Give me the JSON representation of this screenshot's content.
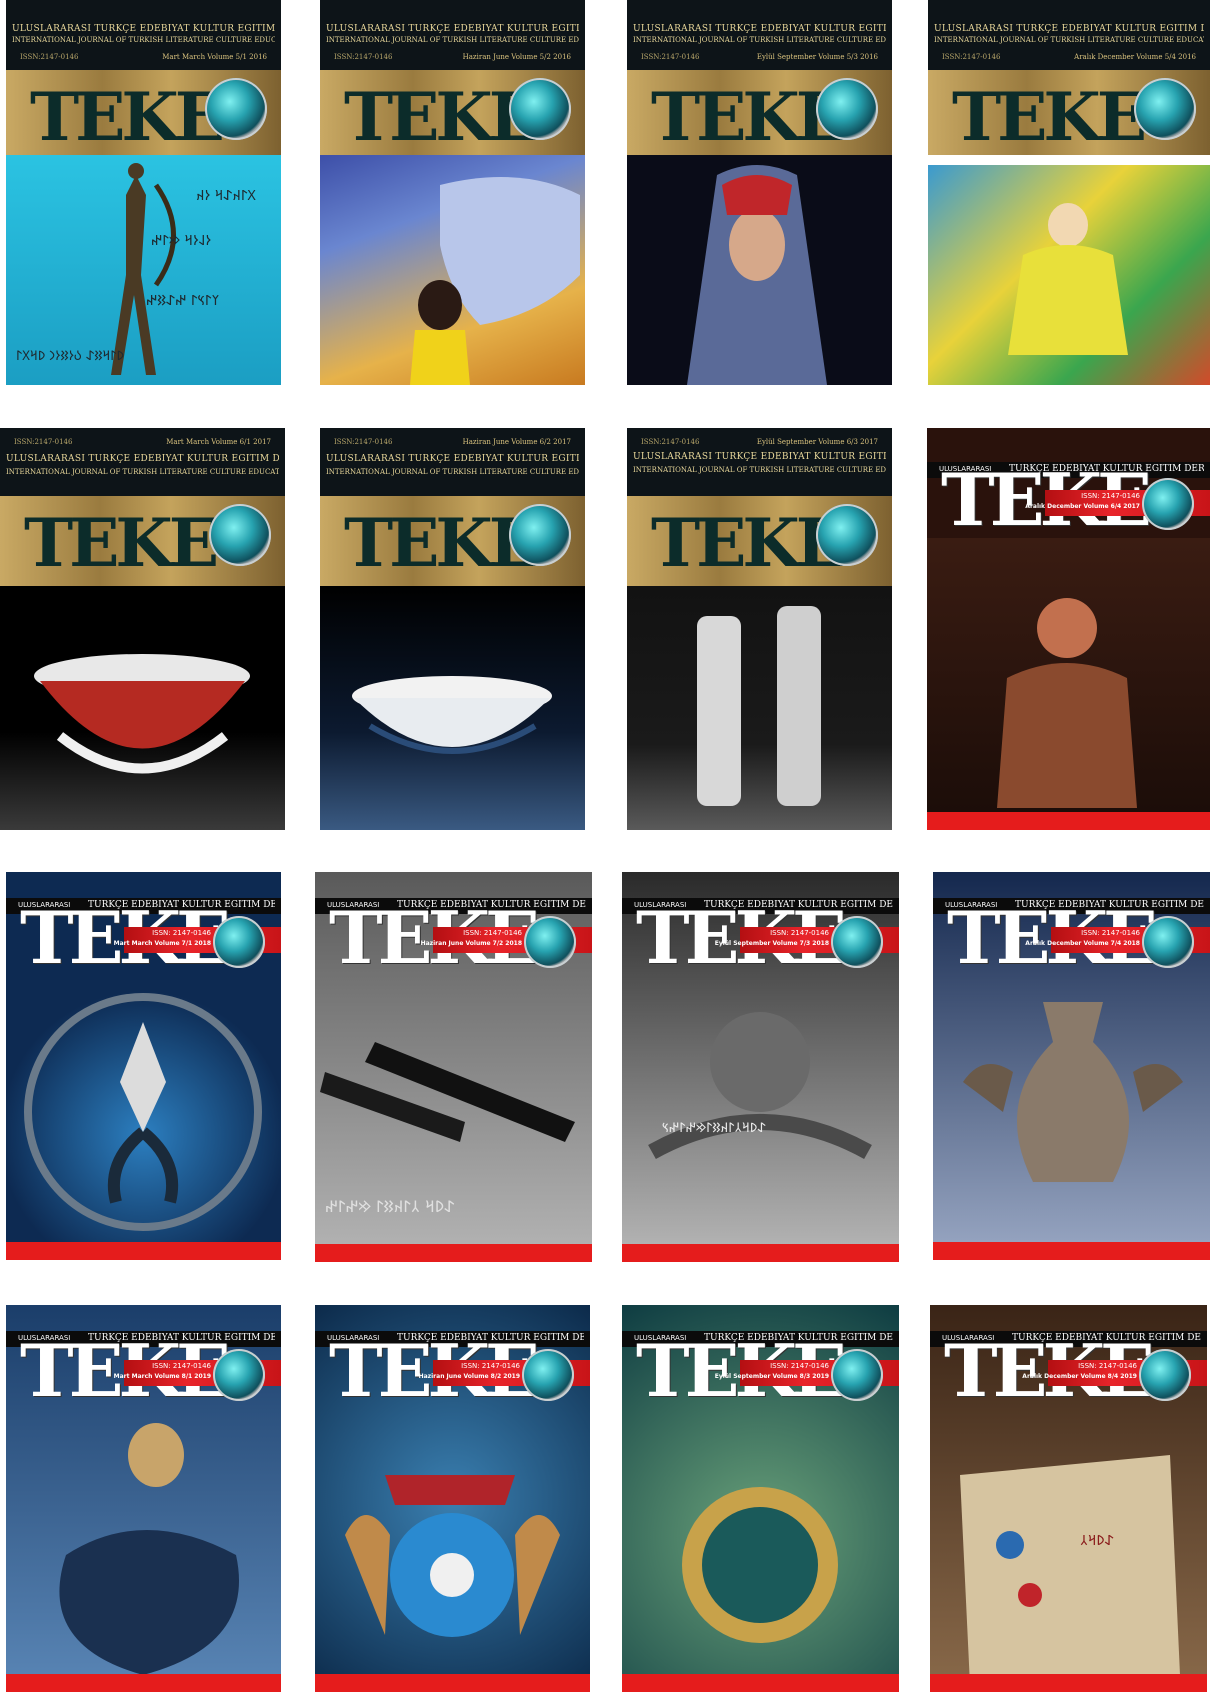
{
  "covers": [
    {
      "style": "gold",
      "title_tr": "ULUSLARARASI TÜRKÇE EDEBİYAT KÜLTÜR EĞİTİM DERGİSİ",
      "title_en": "INTERNATIONAL JOURNAL OF TURKISH LITERATURE CULTURE EDUCATION",
      "issn": "ISSN:2147-0146",
      "issue": "Mart March Volume 5/1 2016",
      "logo": "TEKE",
      "art": "archer statue with Orkhon runes on sky",
      "colors": [
        "#2bb7d6",
        "#1b93b8"
      ]
    },
    {
      "style": "gold",
      "title_tr": "ULUSLARARASI TÜRKÇE EDEBİYAT KÜLTÜR EĞİTİM DERGİSİ",
      "title_en": "INTERNATIONAL JOURNAL OF TURKISH LITERATURE CULTURE EDUCATION",
      "issn": "ISSN:2147-0146",
      "issue": "Haziran June Volume 5/2 2016",
      "logo": "TEKE",
      "art": "girl kissing horse painting",
      "colors": [
        "#5a69b6",
        "#e2a33a"
      ]
    },
    {
      "style": "gold",
      "title_tr": "ULUSLARARASI TÜRKÇE EDEBİYAT KÜLTÜR EĞİTİM DERGİSİ",
      "title_en": "INTERNATIONAL JOURNAL OF TURKISH LITERATURE CULTURE EDUCATION",
      "issn": "ISSN:2147-0146",
      "issue": "Eylül September Volume 5/3 2016",
      "logo": "TEKE",
      "art": "woman with headscarf painting",
      "colors": [
        "#0a0c18",
        "#3b4f86"
      ]
    },
    {
      "style": "gold",
      "title_tr": "ULUSLARARASI TÜRKÇE EDEBİYAT KÜLTÜR EĞİTİM DERGİSİ",
      "title_en": "INTERNATIONAL JOURNAL OF TURKISH LITERATURE CULTURE EDUCATION",
      "issn": "ISSN:2147-0146",
      "issue": "Aralık December Volume 5/4 2016",
      "logo": "TEKE",
      "art": "colorful seated figure painting",
      "colors": [
        "#3aa64e",
        "#e0c63a"
      ]
    },
    {
      "style": "gold",
      "title_tr": "ULUSLARARASI TÜRKÇE EDEBİYAT KÜLTÜR EĞİTİM DERGİSİ",
      "title_en": "INTERNATIONAL JOURNAL OF TURKISH LITERATURE CULTURE EDUCATION",
      "issn": "ISSN:2147-0146",
      "issue": "Mart March Volume 6/1 2017",
      "logo": "TEKE",
      "art": "red decorated bowl",
      "colors": [
        "#000000",
        "#b52a22"
      ]
    },
    {
      "style": "gold",
      "title_tr": "ULUSLARARASI TÜRKÇE EDEBİYAT KÜLTÜR EĞİTİM DERGİSİ",
      "title_en": "INTERNATIONAL JOURNAL OF TURKISH LITERATURE CULTURE EDUCATION",
      "issn": "ISSN:2147-0146",
      "issue": "Haziran June Volume 6/2 2017",
      "logo": "TEKE",
      "art": "blue and white bowl",
      "colors": [
        "#000000",
        "#2a4c78"
      ]
    },
    {
      "style": "gold",
      "title_tr": "ULUSLARARASI TÜRKÇE EDEBİYAT KÜLTÜR EĞİTİM DERGİSİ",
      "title_en": "INTERNATIONAL JOURNAL OF TURKISH LITERATURE CULTURE EDUCATION",
      "issn": "ISSN:2147-0146",
      "issue": "Eylül September Volume 6/3 2017",
      "logo": "TEKE",
      "art": "two stone steles",
      "colors": [
        "#1a1a1a",
        "#9a9a9a"
      ]
    },
    {
      "style": "red",
      "header_a": "ULUSLARARASI",
      "header_b": "TÜRKÇE EDEBİYAT KÜLTÜR EĞİTİM DERGİSİ",
      "issn": "ISSN: 2147-0146",
      "issue": "Aralık December Volume 6/4 2017",
      "logo": "TEKE",
      "art": "carved wooden figure",
      "colors": [
        "#2a120c",
        "#8a4a2e"
      ]
    },
    {
      "style": "red",
      "header_a": "ULUSLARARASI",
      "header_b": "TÜRKÇE EDEBİYAT KÜLTÜR EĞİTİM DERGİSİ",
      "issn": "ISSN: 2147-0146",
      "issue": "Mart March Volume 7/1 2018",
      "logo": "TEKE",
      "art": "ornamental tree motif",
      "colors": [
        "#0d2a52",
        "#2c7fc0"
      ]
    },
    {
      "style": "red",
      "header_a": "ULUSLARARASI",
      "header_b": "TÜRKÇE EDEBİYAT KÜLTÜR EĞİTİM DERGİSİ",
      "issn": "ISSN: 2147-0146",
      "issue": "Haziran June Volume 7/2 2018",
      "logo": "TEKE",
      "art": "fountain pen on runic script",
      "colors": [
        "#6e6e6e",
        "#b0b0b0"
      ]
    },
    {
      "style": "red",
      "header_a": "ULUSLARARASI",
      "header_b": "TÜRKÇE EDEBİYAT KÜLTÜR EĞİTİM DERGİSİ",
      "issn": "ISSN: 2147-0146",
      "issue": "Eylül September Volume 7/3 2018",
      "logo": "TEKE",
      "art": "silver emblem with runes",
      "colors": [
        "#3a3a3a",
        "#a8a8a8"
      ]
    },
    {
      "style": "red",
      "header_a": "ULUSLARARASI",
      "header_b": "TÜRKÇE EDEBİYAT KÜLTÜR EĞİTİM DERGİSİ",
      "issn": "ISSN: 2147-0146",
      "issue": "Aralık December Volume 7/4 2018",
      "logo": "TEKE",
      "art": "vase with horses",
      "colors": [
        "#14284e",
        "#9aa8c4"
      ]
    },
    {
      "style": "red",
      "header_a": "ULUSLARARASI",
      "header_b": "TÜRKÇE EDEBİYAT KÜLTÜR EĞİTİM DERGİSİ",
      "issn": "ISSN: 2147-0146",
      "issue": "Mart March Volume 8/1 2019",
      "logo": "TEKE",
      "art": "ceramic jug with face",
      "colors": [
        "#1b3e6a",
        "#5a86b6"
      ]
    },
    {
      "style": "red",
      "header_a": "ULUSLARARASI",
      "header_b": "TÜRKÇE EDEBİYAT KÜLTÜR EĞİTİM DERGİSİ",
      "issn": "ISSN: 2147-0146",
      "issue": "Haziran June Volume 8/2 2019",
      "logo": "TEKE",
      "art": "coat of arms with griffins",
      "colors": [
        "#0c2a4a",
        "#3a7fb0"
      ]
    },
    {
      "style": "red",
      "header_a": "ULUSLARARASI",
      "header_b": "TÜRKÇE EDEBİYAT KÜLTÜR EĞİTİM DERGİSİ",
      "issn": "ISSN: 2147-0146",
      "issue": "Eylül September Volume 8/3 2019",
      "logo": "TEKE",
      "art": "gold crescent emblem",
      "colors": [
        "#0e3c42",
        "#6aa27a"
      ]
    },
    {
      "style": "red",
      "header_a": "ULUSLARARASI",
      "header_b": "TÜRKÇE EDEBİYAT KÜLTÜR EĞİTİM DERGİSİ",
      "issn": "ISSN: 2147-0146",
      "issue": "Aralık December Volume 8/4 2019",
      "logo": "TEKE",
      "art": "manuscript with figures",
      "colors": [
        "#3a2416",
        "#d6c4a0"
      ]
    }
  ]
}
